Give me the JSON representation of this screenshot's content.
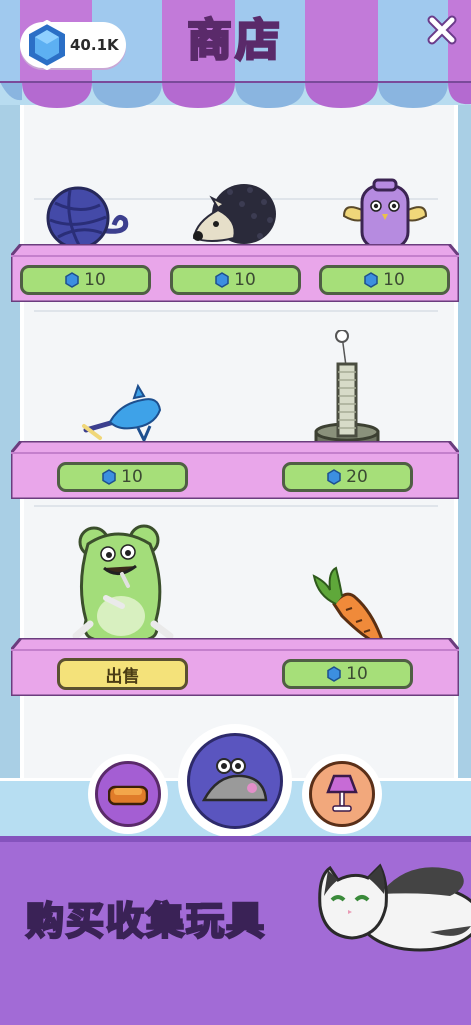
{
  "header": {
    "title": "商店",
    "gem_count": "40.1K"
  },
  "shelves": [
    {
      "items": [
        {
          "name": "yarn-ball",
          "price": "10"
        },
        {
          "name": "hedgehog-toy",
          "price": "10"
        },
        {
          "name": "purple-owl-toy",
          "price": "10"
        }
      ]
    },
    {
      "items": [
        {
          "name": "feather-wand-toy",
          "price": "10"
        },
        {
          "name": "scratching-post",
          "price": "20"
        }
      ]
    },
    {
      "items": [
        {
          "name": "green-mouse-plush",
          "action": "出售"
        },
        {
          "name": "carrot-toy",
          "price": "10"
        }
      ]
    }
  ],
  "tabs": [
    {
      "name": "bed-tab-icon",
      "selected": false
    },
    {
      "name": "mouse-toy-tab-icon",
      "selected": true
    },
    {
      "name": "lamp-tab-icon",
      "selected": false
    }
  ],
  "banner": {
    "slogan": "购买收集玩具"
  },
  "colors": {
    "awning_purple": "#b86fd6",
    "awning_blue": "#8fc0ea",
    "shelf_pink": "#e9a6ea",
    "price_green": "#a6df79",
    "sell_yellow": "#f4e27a",
    "banner_purple": "#a26bd6",
    "gem_blue": "#3c8fe0"
  }
}
